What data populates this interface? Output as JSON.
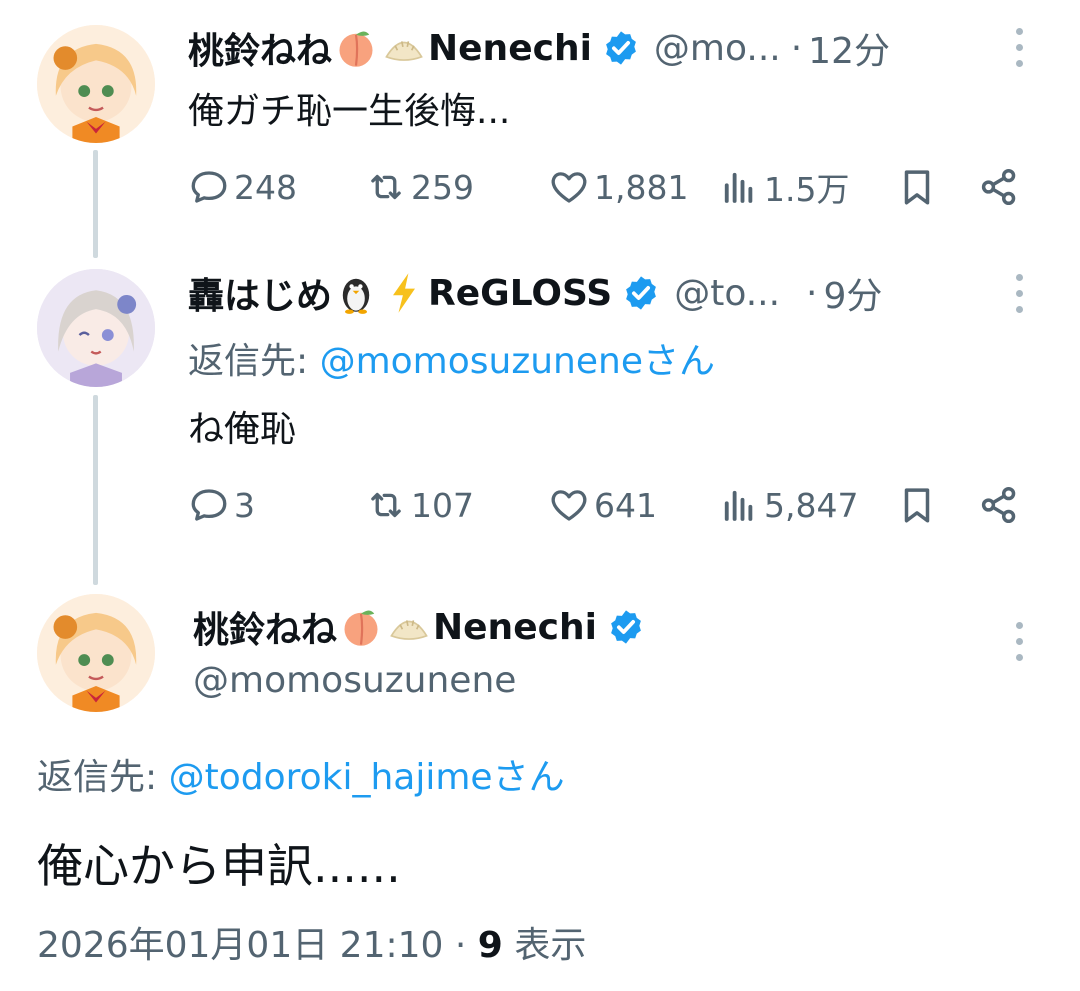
{
  "tweet1": {
    "name": "桃鈴ねね",
    "name_suffix": "Nenechi",
    "emojis": [
      "peach-emoji",
      "dumpling-emoji"
    ],
    "handle": "@mo...",
    "separator": "·",
    "time": "12分",
    "text": "俺ガチ恥一生後悔...",
    "stats": {
      "replies": "248",
      "retweets": "259",
      "likes": "1,881",
      "views": "1.5万"
    }
  },
  "tweet2": {
    "name": "轟はじめ",
    "name_suffix": "ReGLOSS",
    "emojis": [
      "penguin-emoji",
      "lightning-emoji"
    ],
    "handle": "@to...",
    "separator": "·",
    "time": "9分",
    "reply_prefix": "返信先: ",
    "reply_to": "@momosuzuneneさん",
    "text": "ね俺恥",
    "stats": {
      "replies": "3",
      "retweets": "107",
      "likes": "641",
      "views": "5,847"
    }
  },
  "main_tweet": {
    "name": "桃鈴ねね",
    "name_suffix": "Nenechi",
    "handle": "@momosuzunene",
    "reply_prefix": "返信先: ",
    "reply_to": "@todoroki_hajimeさん",
    "text": "俺心から申訳......",
    "timestamp": "2026年01月01日 21:10",
    "separator": "·",
    "views_count": "9",
    "views_label": "表示"
  },
  "icons": [
    "reply-icon",
    "retweet-icon",
    "like-icon",
    "views-icon",
    "bookmark-icon",
    "share-icon",
    "more-icon",
    "verified-badge-icon"
  ],
  "colors": {
    "accent": "#1d9bf0",
    "muted": "#536471",
    "text": "#0f1419",
    "thread_line": "#cfd9de"
  }
}
